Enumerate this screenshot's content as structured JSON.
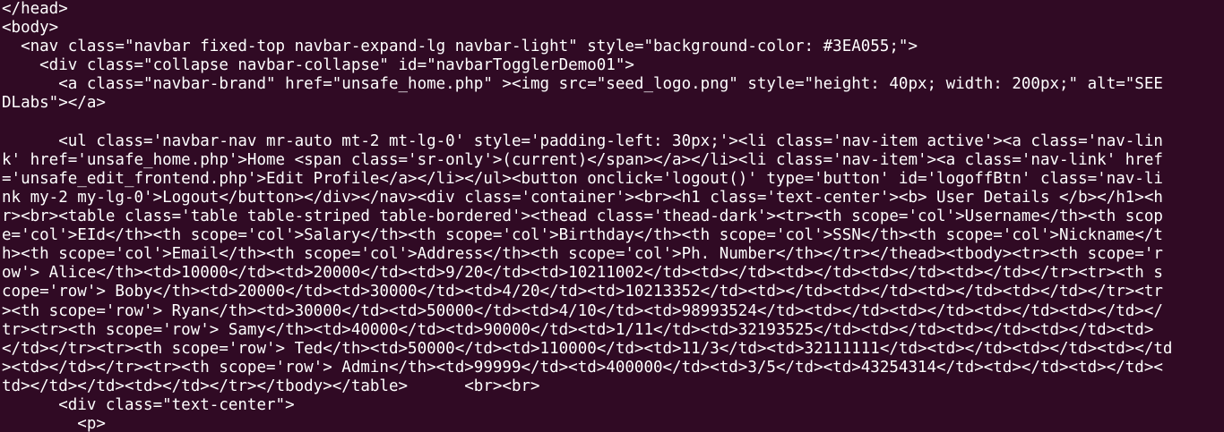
{
  "terminal": {
    "lines": [
      "</head>",
      "<body>",
      "  <nav class=\"navbar fixed-top navbar-expand-lg navbar-light\" style=\"background-color: #3EA055;\">",
      "    <div class=\"collapse navbar-collapse\" id=\"navbarTogglerDemo01\">",
      "      <a class=\"navbar-brand\" href=\"unsafe_home.php\" ><img src=\"seed_logo.png\" style=\"height: 40px; width: 200px;\" alt=\"SEE",
      "DLabs\"></a>",
      "",
      "      <ul class='navbar-nav mr-auto mt-2 mt-lg-0' style='padding-left: 30px;'><li class='nav-item active'><a class='nav-lin",
      "k' href='unsafe_home.php'>Home <span class='sr-only'>(current)</span></a></li><li class='nav-item'><a class='nav-link' href",
      "='unsafe_edit_frontend.php'>Edit Profile</a></li></ul><button onclick='logout()' type='button' id='logoffBtn' class='nav-li",
      "nk my-2 my-lg-0'>Logout</button></div></nav><div class='container'><br><h1 class='text-center'><b> User Details </b></h1><h",
      "r><br><table class='table table-striped table-bordered'><thead class='thead-dark'><tr><th scope='col'>Username</th><th scop",
      "e='col'>EId</th><th scope='col'>Salary</th><th scope='col'>Birthday</th><th scope='col'>SSN</th><th scope='col'>Nickname</t",
      "h><th scope='col'>Email</th><th scope='col'>Address</th><th scope='col'>Ph. Number</th></tr></thead><tbody><tr><th scope='r",
      "ow'> Alice</th><td>10000</td><td>20000</td><td>9/20</td><td>10211002</td><td></td><td></td><td></td><td></td></tr><tr><th s",
      "cope='row'> Boby</th><td>20000</td><td>30000</td><td>4/20</td><td>10213352</td><td></td><td></td><td></td><td></td></tr><tr",
      "><th scope='row'> Ryan</th><td>30000</td><td>50000</td><td>4/10</td><td>98993524</td><td></td><td></td><td></td><td></td></",
      "tr><tr><th scope='row'> Samy</th><td>40000</td><td>90000</td><td>1/11</td><td>32193525</td><td></td><td></td><td></td><td>",
      "</td></tr><tr><th scope='row'> Ted</th><td>50000</td><td>110000</td><td>11/3</td><td>32111111</td><td></td><td></td><td></td",
      "><td></td></tr><tr><th scope='row'> Admin</th><td>99999</td><td>400000</td><td>3/5</td><td>43254314</td><td></td><td></td><",
      "td></td></td><td></td></tr></tbody></table>      <br><br>",
      "      <div class=\"text-center\">",
      "        <p>"
    ]
  }
}
